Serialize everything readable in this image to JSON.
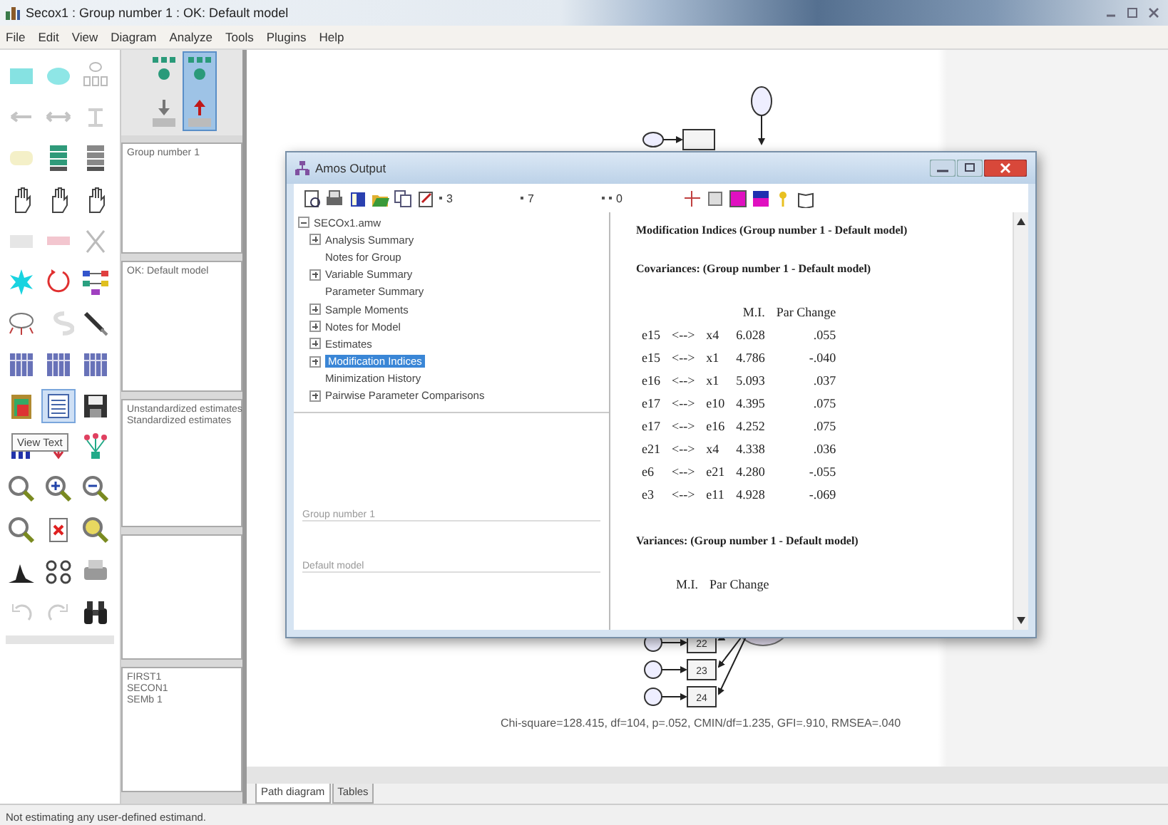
{
  "window": {
    "title": "Secox1 : Group number 1 : OK: Default model"
  },
  "menu": [
    "File",
    "Edit",
    "View",
    "Diagram",
    "Analyze",
    "Tools",
    "Plugins",
    "Help"
  ],
  "toolbox": {
    "tooltip": "View Text",
    "tools": [
      {
        "kind": "rectangle",
        "selected": false
      },
      {
        "kind": "ellipse",
        "selected": false
      },
      {
        "kind": "indicator",
        "selected": false
      },
      {
        "kind": "arrow",
        "selected": false
      },
      {
        "kind": "double-arrow",
        "selected": false
      },
      {
        "kind": "tee",
        "selected": false
      },
      {
        "kind": "swatch",
        "selected": false
      },
      {
        "kind": "list-green",
        "selected": false
      },
      {
        "kind": "list-grey",
        "selected": false
      },
      {
        "kind": "hand",
        "selected": false
      },
      {
        "kind": "hand",
        "selected": false
      },
      {
        "kind": "hand",
        "selected": false
      },
      {
        "kind": "faint-rect",
        "selected": false
      },
      {
        "kind": "tag",
        "selected": false
      },
      {
        "kind": "cross",
        "selected": false
      },
      {
        "kind": "star",
        "selected": false
      },
      {
        "kind": "rotate",
        "selected": false
      },
      {
        "kind": "nodes",
        "selected": false
      },
      {
        "kind": "loop",
        "selected": false
      },
      {
        "kind": "curve",
        "selected": false
      },
      {
        "kind": "pen",
        "selected": false
      },
      {
        "kind": "table",
        "selected": false
      },
      {
        "kind": "table",
        "selected": false
      },
      {
        "kind": "table",
        "selected": false
      },
      {
        "kind": "clipboard",
        "selected": false
      },
      {
        "kind": "document",
        "selected": true
      },
      {
        "kind": "save",
        "selected": false
      },
      {
        "kind": "bars",
        "selected": false
      },
      {
        "kind": "down-arrow",
        "selected": false
      },
      {
        "kind": "tree",
        "selected": false
      },
      {
        "kind": "magnifier",
        "selected": false
      },
      {
        "kind": "zoom-in",
        "selected": false
      },
      {
        "kind": "zoom-out",
        "selected": false
      },
      {
        "kind": "magnifier",
        "selected": false
      },
      {
        "kind": "page",
        "selected": false
      },
      {
        "kind": "magnifier-yellow",
        "selected": false
      },
      {
        "kind": "histogram",
        "selected": false
      },
      {
        "kind": "glasses",
        "selected": false
      },
      {
        "kind": "printer",
        "selected": false
      },
      {
        "kind": "undo",
        "selected": false
      },
      {
        "kind": "redo",
        "selected": false
      },
      {
        "kind": "binoculars",
        "selected": false
      }
    ]
  },
  "views": [
    {
      "kind": "input",
      "selected": false
    },
    {
      "kind": "output",
      "selected": true
    }
  ],
  "panels": {
    "groups": [
      "Group number 1"
    ],
    "models": [
      "OK: Default model"
    ],
    "estimates": [
      "Unstandardized estimates",
      "Standardized estimates"
    ],
    "files": [
      "FIRST1",
      "SECON1",
      "SEMb 1"
    ]
  },
  "diagram": {
    "boxes": [
      "22",
      "23",
      "24"
    ],
    "fit_summary": "Chi-square=128.415, df=104, p=.052, CMIN/df=1.235, GFI=.910, RMSEA=.040"
  },
  "tabs": [
    {
      "label": "Path diagram",
      "selected": true
    },
    {
      "label": "Tables",
      "selected": false
    }
  ],
  "output_window": {
    "title": "Amos Output",
    "toolbar_fields": [
      "3",
      "7",
      "0"
    ],
    "tree": {
      "label": "SECOx1.amw",
      "expanded": true,
      "children": [
        {
          "label": "Analysis Summary",
          "kind": "folder",
          "selected": false
        },
        {
          "label": "Notes for Group",
          "kind": "leaf",
          "selected": false
        },
        {
          "label": "Variable Summary",
          "kind": "folder",
          "selected": false
        },
        {
          "label": "Parameter Summary",
          "kind": "leaf",
          "selected": false
        },
        {
          "label": "Sample Moments",
          "kind": "folder",
          "selected": false
        },
        {
          "label": "Notes for Model",
          "kind": "folder",
          "selected": false
        },
        {
          "label": "Estimates",
          "kind": "folder",
          "selected": false
        },
        {
          "label": "Modification Indices",
          "kind": "folder",
          "selected": true
        },
        {
          "label": "Minimization History",
          "kind": "leaf",
          "selected": false
        },
        {
          "label": "Pairwise Parameter Comparisons",
          "kind": "folder",
          "selected": false
        }
      ]
    },
    "navigation": [
      "Group number 1",
      "Default model"
    ],
    "content": {
      "title": "Modification Indices (Group number 1 - Default model)",
      "sections": [
        {
          "title": "Covariances: (Group number 1 - Default model)",
          "columns": [
            "M.I.",
            "Par Change"
          ],
          "rows": [
            {
              "from": "e15",
              "link": "<-->",
              "to": "x4",
              "mi": "6.028",
              "par_change": ".055"
            },
            {
              "from": "e15",
              "link": "<-->",
              "to": "x1",
              "mi": "4.786",
              "par_change": "-.040"
            },
            {
              "from": "e16",
              "link": "<-->",
              "to": "x1",
              "mi": "5.093",
              "par_change": ".037"
            },
            {
              "from": "e17",
              "link": "<-->",
              "to": "e10",
              "mi": "4.395",
              "par_change": ".075"
            },
            {
              "from": "e17",
              "link": "<-->",
              "to": "e16",
              "mi": "4.252",
              "par_change": ".075"
            },
            {
              "from": "e21",
              "link": "<-->",
              "to": "x4",
              "mi": "4.338",
              "par_change": ".036"
            },
            {
              "from": "e6",
              "link": "<-->",
              "to": "e21",
              "mi": "4.280",
              "par_change": "-.055"
            },
            {
              "from": "e3",
              "link": "<-->",
              "to": "e11",
              "mi": "4.928",
              "par_change": "-.069"
            }
          ]
        },
        {
          "title": "Variances: (Group number 1 - Default model)",
          "columns": [
            "M.I.",
            "Par Change"
          ]
        }
      ]
    }
  },
  "status_bar": "Not estimating any user-defined estimand."
}
